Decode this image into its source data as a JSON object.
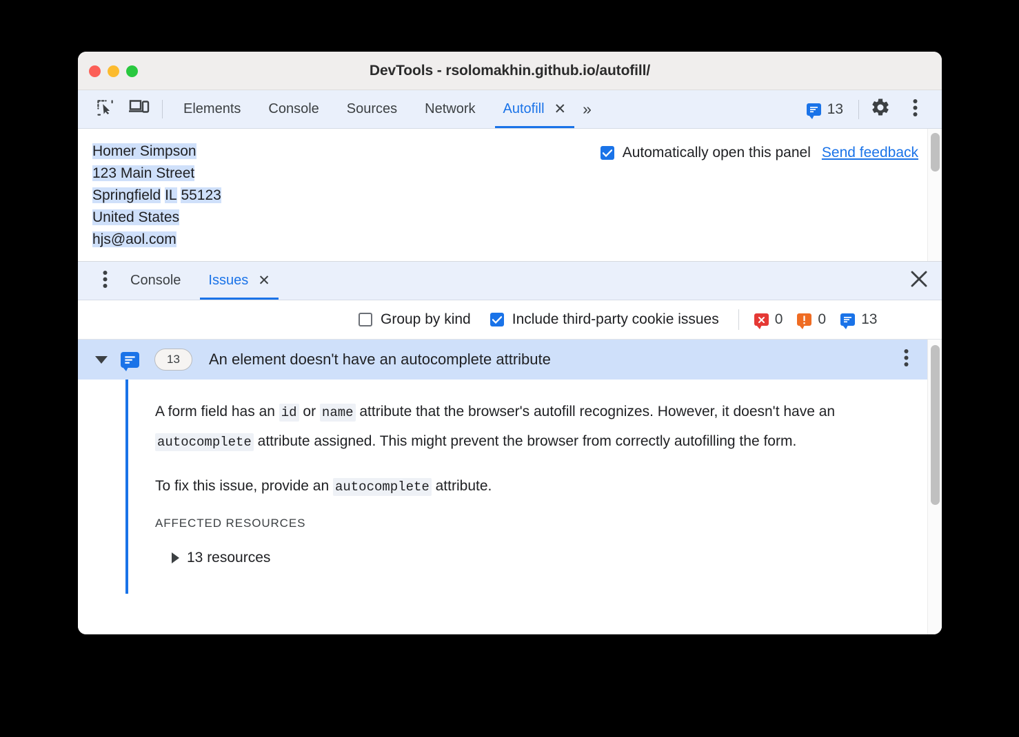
{
  "window": {
    "title": "DevTools - rsolomakhin.github.io/autofill/",
    "traffic_lights": [
      "close",
      "minimize",
      "zoom"
    ]
  },
  "devtools_toolbar": {
    "icons": [
      {
        "name": "inspect-element-icon",
        "label": "Inspect element"
      },
      {
        "name": "device-toolbar-icon",
        "label": "Toggle device toolbar"
      }
    ],
    "tabs": [
      {
        "label": "Elements",
        "active": false,
        "closable": false
      },
      {
        "label": "Console",
        "active": false,
        "closable": false
      },
      {
        "label": "Sources",
        "active": false,
        "closable": false
      },
      {
        "label": "Network",
        "active": false,
        "closable": false
      },
      {
        "label": "Autofill",
        "active": true,
        "closable": true
      }
    ],
    "more_tabs_label": "»",
    "tab_close_label": "✕",
    "issues_count": "13",
    "settings_label": "Settings",
    "main_menu_label": "Customize and control DevTools"
  },
  "autofill_panel": {
    "address_lines": [
      [
        {
          "text": "Homer Simpson",
          "highlighted": true
        }
      ],
      [
        {
          "text": "123 Main Street",
          "highlighted": true
        }
      ],
      [
        {
          "text": "Springfield",
          "highlighted": true
        },
        {
          "text": " ",
          "highlighted": false
        },
        {
          "text": "IL",
          "highlighted": true
        },
        {
          "text": " ",
          "highlighted": false
        },
        {
          "text": "55123",
          "highlighted": true
        }
      ],
      [
        {
          "text": "United States",
          "highlighted": true
        }
      ],
      [
        {
          "text": "hjs@aol.com",
          "highlighted": true
        }
      ]
    ],
    "auto_open_checkbox": {
      "label": "Automatically open this panel",
      "checked": true
    },
    "send_feedback_label": "Send feedback"
  },
  "drawer": {
    "tabs": [
      {
        "label": "Console",
        "active": false,
        "closable": false
      },
      {
        "label": "Issues",
        "active": true,
        "closable": true
      }
    ],
    "tab_close_label": "✕",
    "close_label": "✕",
    "more_tools_label": "More tools"
  },
  "issues_filters": {
    "group_by_kind": {
      "label": "Group by kind",
      "checked": false
    },
    "third_party_cookies": {
      "label": "Include third-party cookie issues",
      "checked": true
    },
    "counts": [
      {
        "kind": "error",
        "value": "0",
        "color": "#e53935"
      },
      {
        "kind": "warning",
        "value": "0",
        "color": "#ef6c23"
      },
      {
        "kind": "info",
        "value": "13",
        "color": "#1a73e8"
      }
    ]
  },
  "issue": {
    "expanded": true,
    "kind_icon": "info-bubble-icon",
    "count_badge": "13",
    "title": "An element doesn't have an autocomplete attribute",
    "paragraph1": {
      "part1": "A form field has an ",
      "code1": "id",
      "part2": " or ",
      "code2": "name",
      "part3": " attribute that the browser's autofill recognizes. However, it doesn't have an ",
      "code3": "autocomplete",
      "part4": " attribute assigned. This might prevent the browser from correctly autofilling the form."
    },
    "paragraph2": {
      "part1": "To fix this issue, provide an ",
      "code1": "autocomplete",
      "part2": " attribute."
    },
    "affected_resources_heading": "AFFECTED RESOURCES",
    "resources_label": "13 resources"
  },
  "colors": {
    "accent_blue": "#1a73e8",
    "selection_blue": "#cfe0fa",
    "toolbar_blue": "#eaf0fb",
    "titlebar_gray": "#f0eeed",
    "error_red": "#e53935",
    "warning_orange": "#ef6c23"
  }
}
